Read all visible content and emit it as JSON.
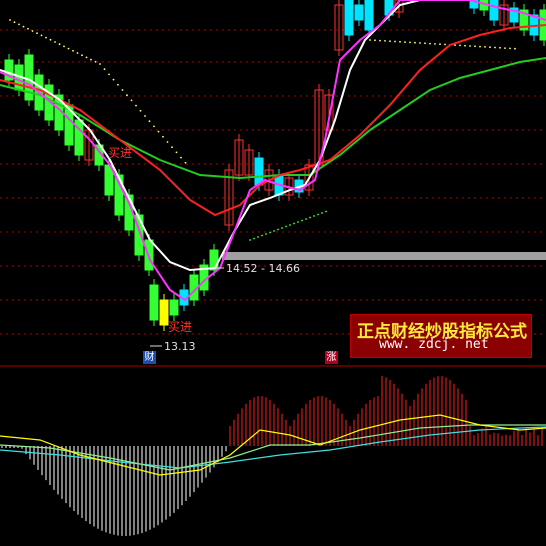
{
  "colors": {
    "background": "#000000",
    "up_candle": "#ff3030",
    "down_candle": "#00e5ff",
    "strong_candle": "#33ff33",
    "ma_white": "#ffffff",
    "ma_magenta": "#ff33ff",
    "ma_red": "#ff2020",
    "ma_green": "#22cc22",
    "sar_dots": "#ffff66",
    "grid": "#b00000",
    "hist_pos": "#ff2020",
    "hist_neg": "#ffffff",
    "macd_dif": "#ffff00",
    "macd_dea": "#40e0e0",
    "macd_sig": "#90ee90"
  },
  "labels": {
    "range_label": "14.52 - 14.66",
    "low_label": "13.13",
    "buy_label_1": "买进",
    "buy_label_2": "买进",
    "tag_cai": "财",
    "tag_zhang": "涨"
  },
  "watermark": {
    "title": "正点财经炒股指标公式",
    "url": "www. zdcj. net"
  },
  "chart_data": {
    "type": "candlestick",
    "price_annotations": [
      13.13,
      14.52,
      14.66
    ],
    "highlight_band": [
      14.52,
      14.66
    ],
    "series": [
      {
        "name": "",
        "kind": "moving-average",
        "color": "#ffffff"
      },
      {
        "name": "",
        "kind": "moving-average",
        "color": "#ff33ff"
      },
      {
        "name": "",
        "kind": "moving-average",
        "color": "#ff2020"
      },
      {
        "name": "",
        "kind": "moving-average",
        "color": "#22cc22"
      },
      {
        "name": "",
        "kind": "sar-dots",
        "color": "#ffff66"
      }
    ],
    "lower_panel": {
      "type": "macd-histogram",
      "series": [
        {
          "name": "",
          "color": "#ffff00"
        },
        {
          "name": "",
          "color": "#40e0e0"
        },
        {
          "name": "",
          "color": "#90ee90"
        }
      ]
    },
    "grid": true
  }
}
